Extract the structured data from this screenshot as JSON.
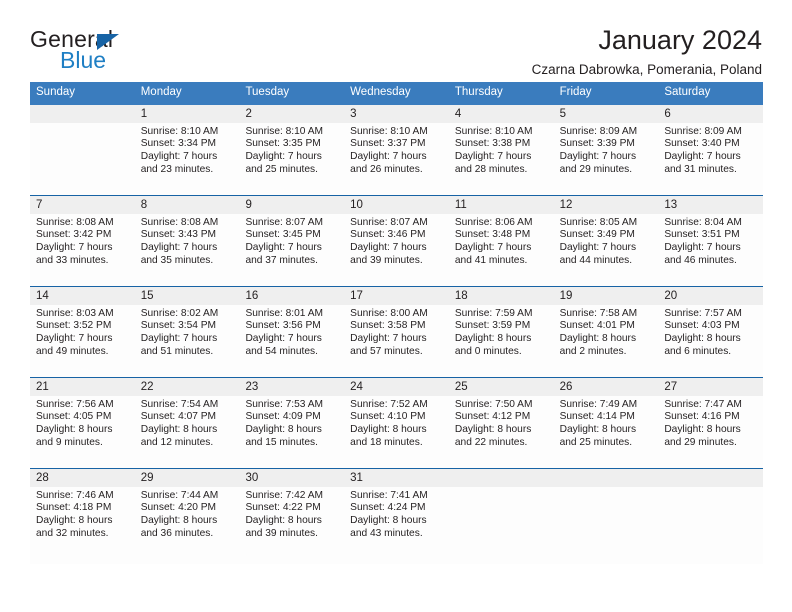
{
  "brand": {
    "name_top": "General",
    "name_bottom": "Blue",
    "triangle_color": "#1763a5",
    "accent_color": "#1f7fc4"
  },
  "header": {
    "title": "January 2024",
    "subtitle": "Czarna Dabrowka, Pomerania, Poland"
  },
  "theme": {
    "header_band": "#3a7cbe",
    "row_separator": "#1763a5",
    "daynum_band": "#efefef",
    "text": "#231f20"
  },
  "weekdays": [
    "Sunday",
    "Monday",
    "Tuesday",
    "Wednesday",
    "Thursday",
    "Friday",
    "Saturday"
  ],
  "labels": {
    "sunrise_prefix": "Sunrise:",
    "sunset_prefix": "Sunset:",
    "daylight_prefix": "Daylight:"
  },
  "weeks": [
    [
      {
        "day": ""
      },
      {
        "day": "1",
        "line1": "Sunrise: 8:10 AM",
        "line2": "Sunset: 3:34 PM",
        "line3": "Daylight: 7 hours",
        "line4": "and 23 minutes."
      },
      {
        "day": "2",
        "line1": "Sunrise: 8:10 AM",
        "line2": "Sunset: 3:35 PM",
        "line3": "Daylight: 7 hours",
        "line4": "and 25 minutes."
      },
      {
        "day": "3",
        "line1": "Sunrise: 8:10 AM",
        "line2": "Sunset: 3:37 PM",
        "line3": "Daylight: 7 hours",
        "line4": "and 26 minutes."
      },
      {
        "day": "4",
        "line1": "Sunrise: 8:10 AM",
        "line2": "Sunset: 3:38 PM",
        "line3": "Daylight: 7 hours",
        "line4": "and 28 minutes."
      },
      {
        "day": "5",
        "line1": "Sunrise: 8:09 AM",
        "line2": "Sunset: 3:39 PM",
        "line3": "Daylight: 7 hours",
        "line4": "and 29 minutes."
      },
      {
        "day": "6",
        "line1": "Sunrise: 8:09 AM",
        "line2": "Sunset: 3:40 PM",
        "line3": "Daylight: 7 hours",
        "line4": "and 31 minutes."
      }
    ],
    [
      {
        "day": "7",
        "line1": "Sunrise: 8:08 AM",
        "line2": "Sunset: 3:42 PM",
        "line3": "Daylight: 7 hours",
        "line4": "and 33 minutes."
      },
      {
        "day": "8",
        "line1": "Sunrise: 8:08 AM",
        "line2": "Sunset: 3:43 PM",
        "line3": "Daylight: 7 hours",
        "line4": "and 35 minutes."
      },
      {
        "day": "9",
        "line1": "Sunrise: 8:07 AM",
        "line2": "Sunset: 3:45 PM",
        "line3": "Daylight: 7 hours",
        "line4": "and 37 minutes."
      },
      {
        "day": "10",
        "line1": "Sunrise: 8:07 AM",
        "line2": "Sunset: 3:46 PM",
        "line3": "Daylight: 7 hours",
        "line4": "and 39 minutes."
      },
      {
        "day": "11",
        "line1": "Sunrise: 8:06 AM",
        "line2": "Sunset: 3:48 PM",
        "line3": "Daylight: 7 hours",
        "line4": "and 41 minutes."
      },
      {
        "day": "12",
        "line1": "Sunrise: 8:05 AM",
        "line2": "Sunset: 3:49 PM",
        "line3": "Daylight: 7 hours",
        "line4": "and 44 minutes."
      },
      {
        "day": "13",
        "line1": "Sunrise: 8:04 AM",
        "line2": "Sunset: 3:51 PM",
        "line3": "Daylight: 7 hours",
        "line4": "and 46 minutes."
      }
    ],
    [
      {
        "day": "14",
        "line1": "Sunrise: 8:03 AM",
        "line2": "Sunset: 3:52 PM",
        "line3": "Daylight: 7 hours",
        "line4": "and 49 minutes."
      },
      {
        "day": "15",
        "line1": "Sunrise: 8:02 AM",
        "line2": "Sunset: 3:54 PM",
        "line3": "Daylight: 7 hours",
        "line4": "and 51 minutes."
      },
      {
        "day": "16",
        "line1": "Sunrise: 8:01 AM",
        "line2": "Sunset: 3:56 PM",
        "line3": "Daylight: 7 hours",
        "line4": "and 54 minutes."
      },
      {
        "day": "17",
        "line1": "Sunrise: 8:00 AM",
        "line2": "Sunset: 3:58 PM",
        "line3": "Daylight: 7 hours",
        "line4": "and 57 minutes."
      },
      {
        "day": "18",
        "line1": "Sunrise: 7:59 AM",
        "line2": "Sunset: 3:59 PM",
        "line3": "Daylight: 8 hours",
        "line4": "and 0 minutes."
      },
      {
        "day": "19",
        "line1": "Sunrise: 7:58 AM",
        "line2": "Sunset: 4:01 PM",
        "line3": "Daylight: 8 hours",
        "line4": "and 2 minutes."
      },
      {
        "day": "20",
        "line1": "Sunrise: 7:57 AM",
        "line2": "Sunset: 4:03 PM",
        "line3": "Daylight: 8 hours",
        "line4": "and 6 minutes."
      }
    ],
    [
      {
        "day": "21",
        "line1": "Sunrise: 7:56 AM",
        "line2": "Sunset: 4:05 PM",
        "line3": "Daylight: 8 hours",
        "line4": "and 9 minutes."
      },
      {
        "day": "22",
        "line1": "Sunrise: 7:54 AM",
        "line2": "Sunset: 4:07 PM",
        "line3": "Daylight: 8 hours",
        "line4": "and 12 minutes."
      },
      {
        "day": "23",
        "line1": "Sunrise: 7:53 AM",
        "line2": "Sunset: 4:09 PM",
        "line3": "Daylight: 8 hours",
        "line4": "and 15 minutes."
      },
      {
        "day": "24",
        "line1": "Sunrise: 7:52 AM",
        "line2": "Sunset: 4:10 PM",
        "line3": "Daylight: 8 hours",
        "line4": "and 18 minutes."
      },
      {
        "day": "25",
        "line1": "Sunrise: 7:50 AM",
        "line2": "Sunset: 4:12 PM",
        "line3": "Daylight: 8 hours",
        "line4": "and 22 minutes."
      },
      {
        "day": "26",
        "line1": "Sunrise: 7:49 AM",
        "line2": "Sunset: 4:14 PM",
        "line3": "Daylight: 8 hours",
        "line4": "and 25 minutes."
      },
      {
        "day": "27",
        "line1": "Sunrise: 7:47 AM",
        "line2": "Sunset: 4:16 PM",
        "line3": "Daylight: 8 hours",
        "line4": "and 29 minutes."
      }
    ],
    [
      {
        "day": "28",
        "line1": "Sunrise: 7:46 AM",
        "line2": "Sunset: 4:18 PM",
        "line3": "Daylight: 8 hours",
        "line4": "and 32 minutes."
      },
      {
        "day": "29",
        "line1": "Sunrise: 7:44 AM",
        "line2": "Sunset: 4:20 PM",
        "line3": "Daylight: 8 hours",
        "line4": "and 36 minutes."
      },
      {
        "day": "30",
        "line1": "Sunrise: 7:42 AM",
        "line2": "Sunset: 4:22 PM",
        "line3": "Daylight: 8 hours",
        "line4": "and 39 minutes."
      },
      {
        "day": "31",
        "line1": "Sunrise: 7:41 AM",
        "line2": "Sunset: 4:24 PM",
        "line3": "Daylight: 8 hours",
        "line4": "and 43 minutes."
      },
      {
        "day": ""
      },
      {
        "day": ""
      },
      {
        "day": ""
      }
    ]
  ]
}
